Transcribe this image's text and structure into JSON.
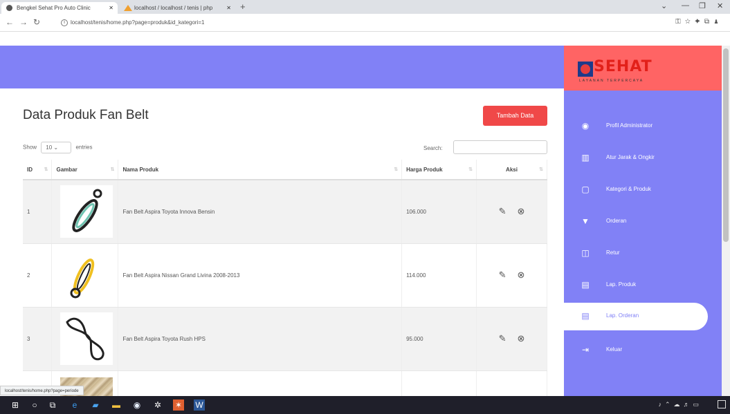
{
  "browser": {
    "tabs": [
      {
        "title": "Bengkel Sehat Pro Auto Clinic",
        "active": true
      },
      {
        "title": "localhost / localhost / tenis | php",
        "active": false
      }
    ],
    "new_tab": "+",
    "url": "localhost/tenis/home.php?page=produk&id_kategori=1",
    "status_url": "localhost/tenis/home.php?page=periode"
  },
  "brand": {
    "name": "SEHAT",
    "tagline": "LAYANAN TERPERCAYA"
  },
  "sidebar": {
    "items": [
      {
        "label": "Profil Administrator",
        "icon": "user-circle-icon",
        "glyph": "◉",
        "active": false
      },
      {
        "label": "Atur Jarak & Ongkir",
        "icon": "map-icon",
        "glyph": "▥",
        "active": false
      },
      {
        "label": "Kategori & Produk",
        "icon": "box-icon",
        "glyph": "▢",
        "active": false
      },
      {
        "label": "Orderan",
        "icon": "cart-icon",
        "glyph": "▼",
        "active": false
      },
      {
        "label": "Retur",
        "icon": "return-icon",
        "glyph": "◫",
        "active": false
      },
      {
        "label": "Lap. Produk",
        "icon": "print-icon",
        "glyph": "▤",
        "active": false
      },
      {
        "label": "Lap. Orderan",
        "icon": "print-icon",
        "glyph": "▤",
        "active": true
      },
      {
        "label": "Keluar",
        "icon": "logout-icon",
        "glyph": "⇥",
        "active": false
      }
    ]
  },
  "main": {
    "title": "Data Produk Fan Belt",
    "add_button": "Tambah Data",
    "show_prefix": "Show",
    "entries_value": "10",
    "show_suffix": "entries",
    "search_label": "Search:",
    "columns": [
      "ID",
      "Gambar",
      "Nama Produk",
      "Harga Produk",
      "Aksi"
    ],
    "rows": [
      {
        "id": "1",
        "name": "Fan Belt Aspira Toyota Innova Bensin",
        "price": "106.000"
      },
      {
        "id": "2",
        "name": "Fan Belt Aspira Nissan Grand Livina 2008-2013",
        "price": "114.000"
      },
      {
        "id": "3",
        "name": "Fan Belt Aspira Toyota Rush HPS",
        "price": "95.000"
      }
    ]
  },
  "colors": {
    "accent": "#8181f6",
    "brand_bg": "#ff6464",
    "button": "#f04848"
  }
}
